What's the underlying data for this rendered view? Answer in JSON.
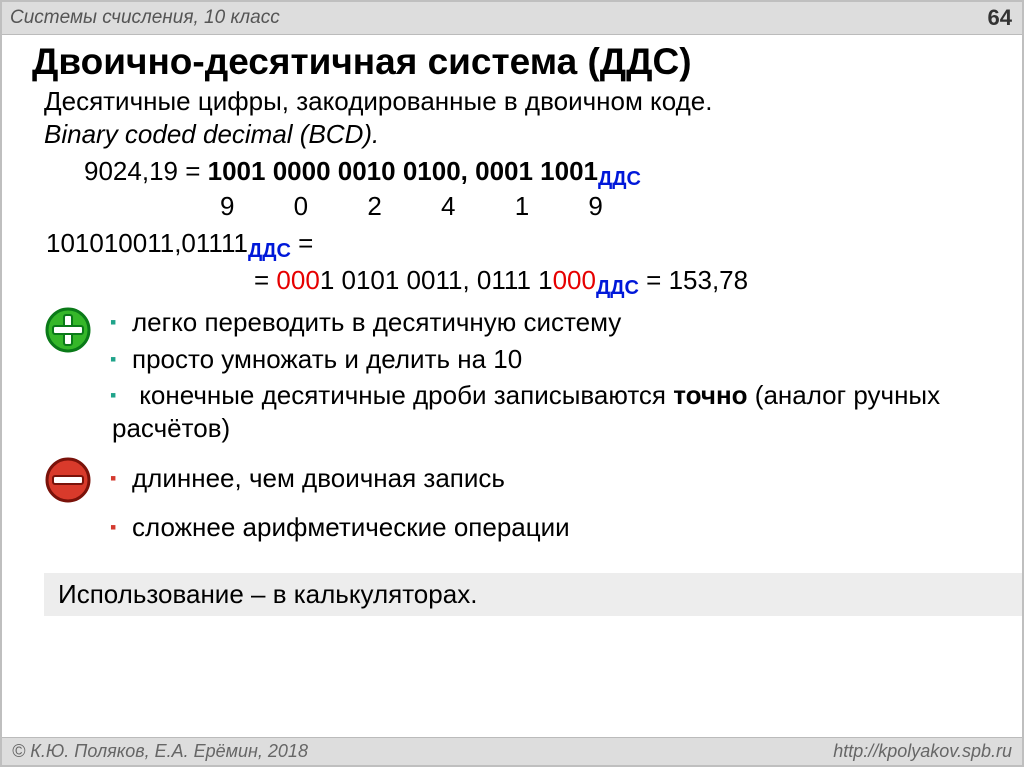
{
  "header": {
    "course": "Системы счисления, 10 класс",
    "page": "64"
  },
  "title": "Двоично-десятичная система (ДДС)",
  "intro": {
    "ru": "Десятичные цифры, закодированные в двоичном коде.",
    "en": "Binary coded decimal (BCD)."
  },
  "example1": {
    "lhs": "9024,19 = ",
    "bcd": "1001 0000 0010 0100, 0001 1001",
    "sub": "ДДС",
    "digits": "9 0 2 4 1 9"
  },
  "example2": {
    "lhs": "101010011,01111",
    "sub1": "ДДС",
    "eq": " =",
    "line2_prefix": "= ",
    "red": "000",
    "mid": "1 0101 0011, 0111 1",
    "red2": "000",
    "sub2": "ДДС",
    "result": " = 153,78"
  },
  "pros": [
    "легко переводить в десятичную систему",
    "просто умножать и делить на 10",
    {
      "pre": "конечные десятичные дроби записываются ",
      "bold": "точно",
      "post": " (аналог ручных расчётов)"
    }
  ],
  "cons": [
    "длиннее, чем двоичная запись",
    "сложнее арифметические операции"
  ],
  "usage": "Использование – в калькуляторах.",
  "footer": {
    "left": "© К.Ю. Поляков, Е.А. Ерёмин, 2018",
    "right": "http://kpolyakov.spb.ru"
  }
}
